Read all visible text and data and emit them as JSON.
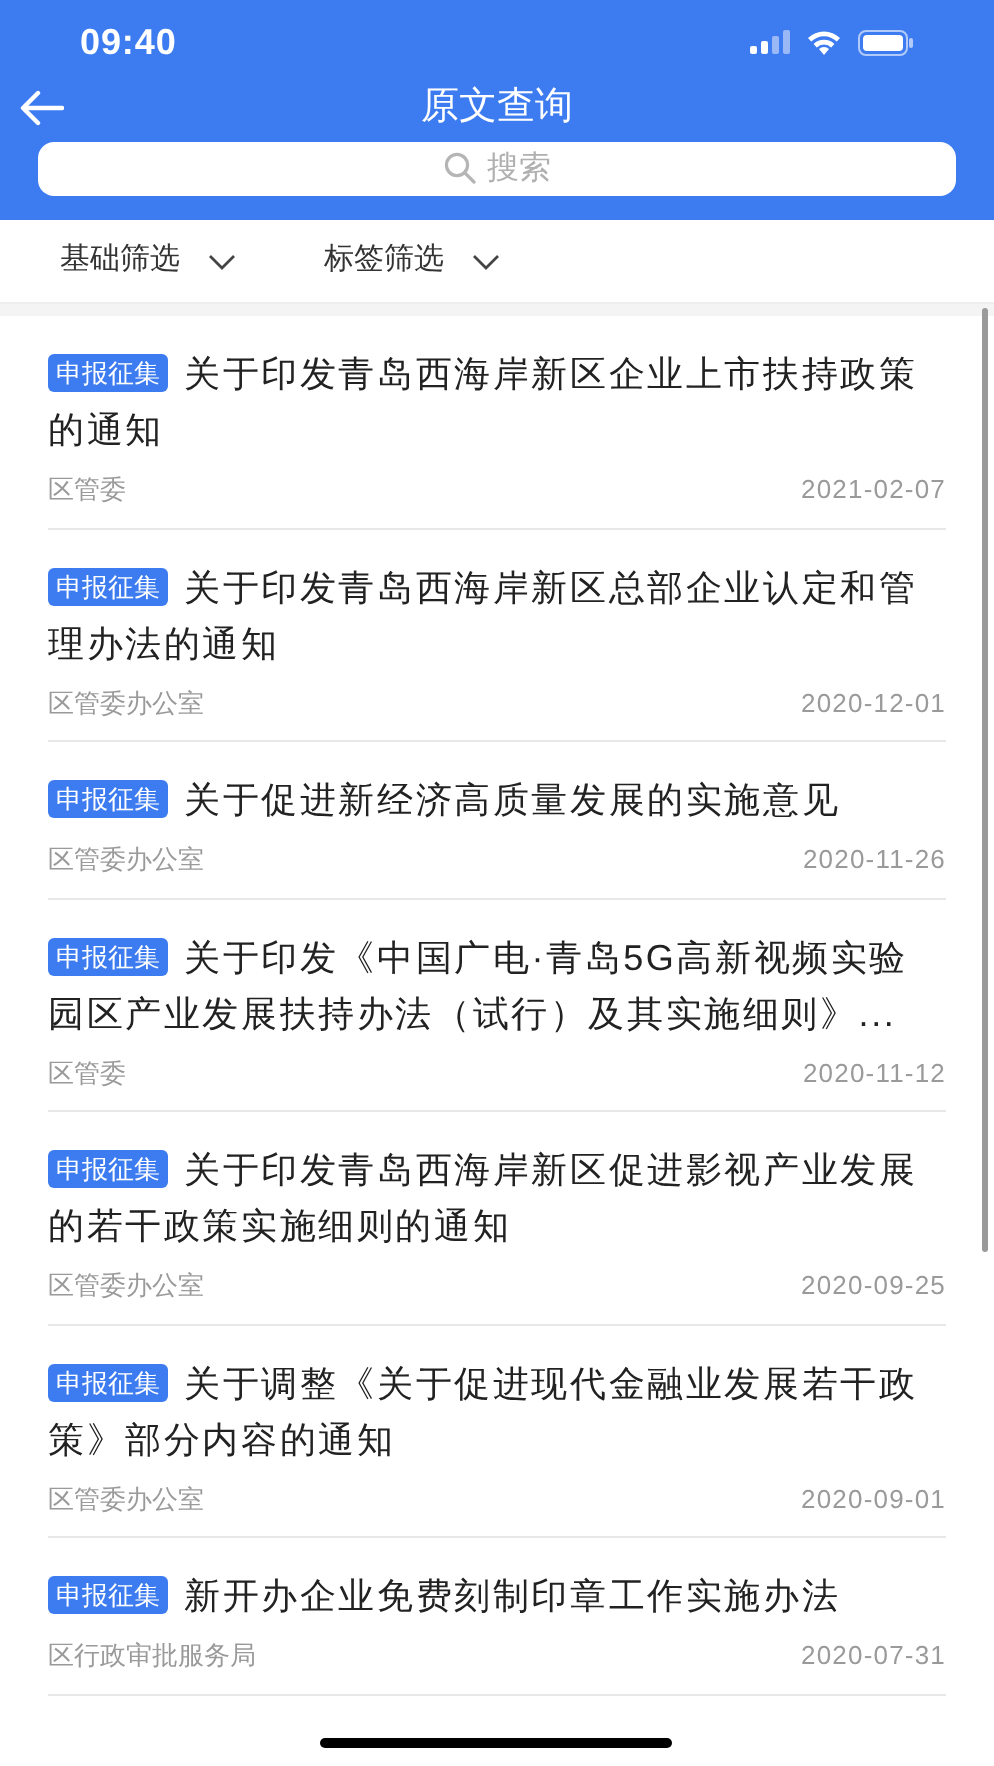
{
  "status_bar": {
    "time": "09:40"
  },
  "header": {
    "title": "原文查询",
    "search": {
      "placeholder": "搜索"
    }
  },
  "filters": [
    {
      "label": "基础筛选"
    },
    {
      "label": "标签筛选"
    }
  ],
  "items": [
    {
      "tag": "申报征集",
      "title": "关于印发青岛西海岸新区企业上市扶持政策的通知",
      "source": "区管委",
      "date": "2021-02-07"
    },
    {
      "tag": "申报征集",
      "title": "关于印发青岛西海岸新区总部企业认定和管理办法的通知",
      "source": "区管委办公室",
      "date": "2020-12-01"
    },
    {
      "tag": "申报征集",
      "title": "关于促进新经济高质量发展的实施意见",
      "source": "区管委办公室",
      "date": "2020-11-26"
    },
    {
      "tag": "申报征集",
      "title": "关于印发《中国广电·青岛5G高新视频实验园区产业发展扶持办法（试行）及其实施细则》...",
      "source": "区管委",
      "date": "2020-11-12"
    },
    {
      "tag": "申报征集",
      "title": "关于印发青岛西海岸新区促进影视产业发展的若干政策实施细则的通知",
      "source": "区管委办公室",
      "date": "2020-09-25"
    },
    {
      "tag": "申报征集",
      "title": "关于调整《关于促进现代金融业发展若干政策》部分内容的通知",
      "source": "区管委办公室",
      "date": "2020-09-01"
    },
    {
      "tag": "申报征集",
      "title": "新开办企业免费刻制印章工作实施办法",
      "source": "区行政审批服务局",
      "date": "2020-07-31"
    }
  ]
}
